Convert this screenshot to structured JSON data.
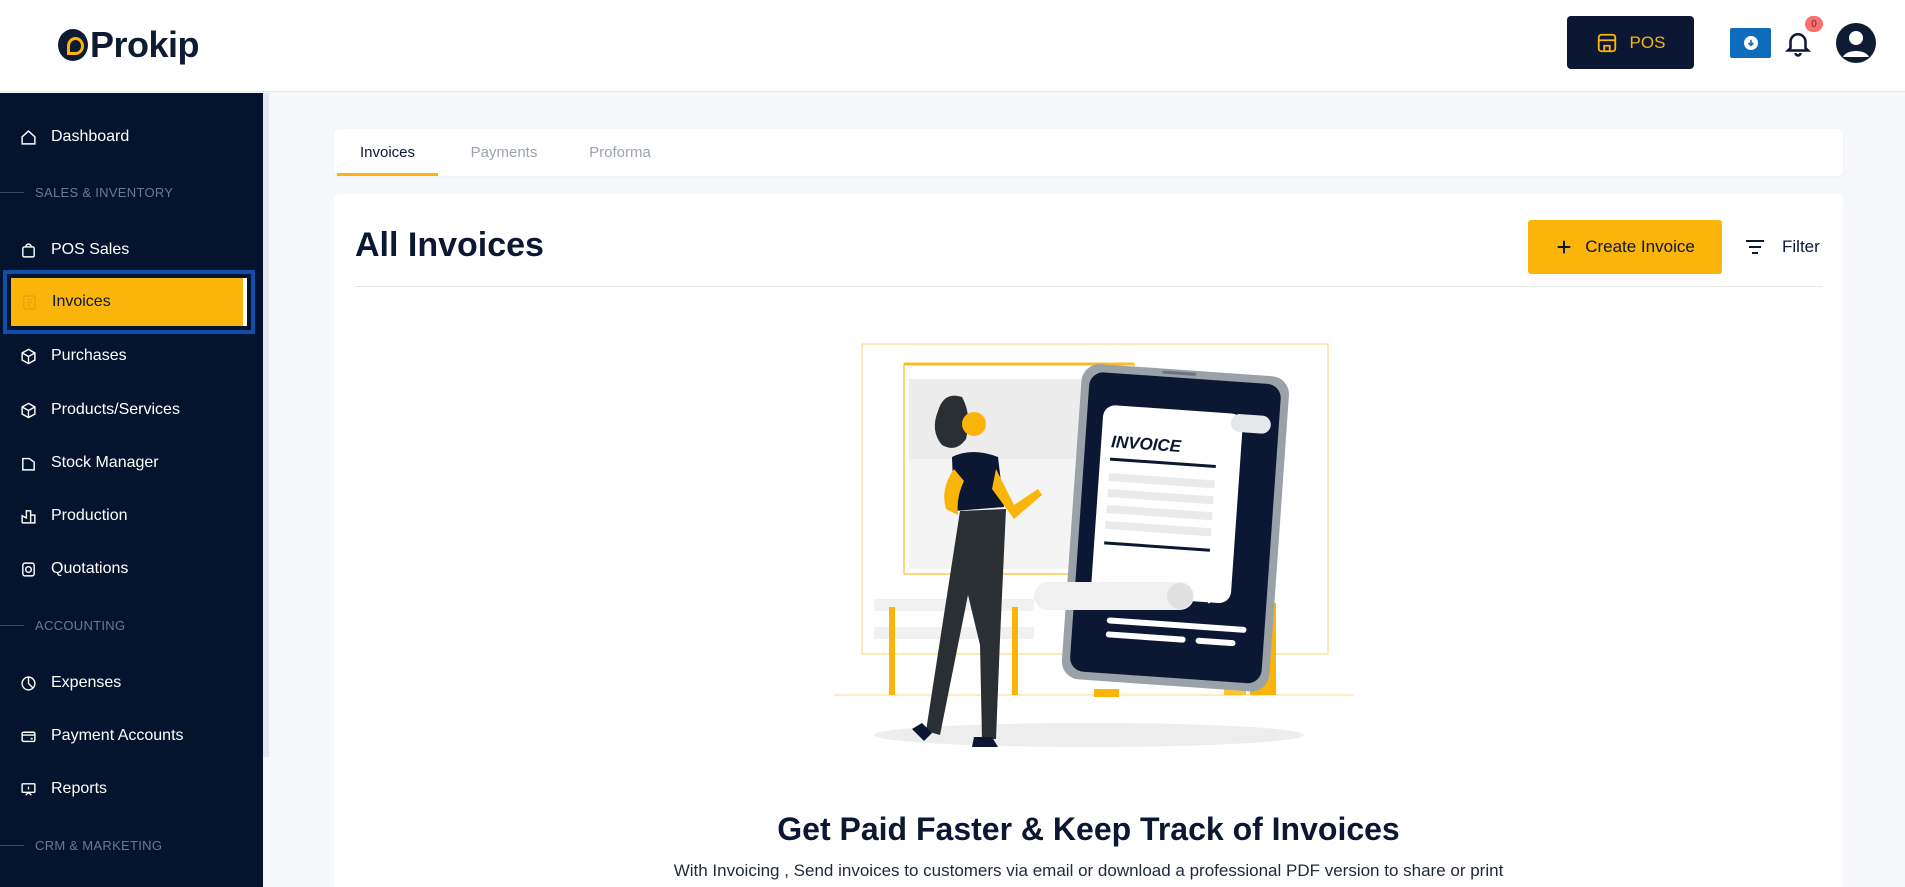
{
  "app": {
    "name": "Prokip"
  },
  "header": {
    "pos_label": "POS",
    "notification_count": "0",
    "icons": {
      "pos": "store-icon",
      "download": "download-icon",
      "bell": "bell-icon",
      "user": "user-avatar-icon"
    }
  },
  "sidebar": {
    "items": [
      {
        "label": "Dashboard",
        "icon": "home-icon"
      },
      {
        "section": "SALES & INVENTORY"
      },
      {
        "label": "POS Sales",
        "icon": "shopping-bag-icon"
      },
      {
        "label": "Invoices",
        "icon": "invoice-icon",
        "active": true
      },
      {
        "label": "Purchases",
        "icon": "box-icon"
      },
      {
        "label": "Products/Services",
        "icon": "cube-icon"
      },
      {
        "label": "Stock Manager",
        "icon": "folder-icon"
      },
      {
        "label": "Production",
        "icon": "factory-icon"
      },
      {
        "label": "Quotations",
        "icon": "quote-icon"
      },
      {
        "section": "ACCOUNTING"
      },
      {
        "label": "Expenses",
        "icon": "pie-icon"
      },
      {
        "label": "Payment Accounts",
        "icon": "wallet-icon"
      },
      {
        "label": "Reports",
        "icon": "presentation-icon"
      },
      {
        "section": "CRM & MARKETING"
      }
    ]
  },
  "tabs": [
    {
      "label": "Invoices",
      "active": true
    },
    {
      "label": "Payments",
      "active": false
    },
    {
      "label": "Proforma",
      "active": false
    }
  ],
  "main": {
    "title": "All Invoices",
    "create_label": "Create Invoice",
    "filter_label": "Filter",
    "illustration_text": "INVOICE",
    "illustration_currency": "$",
    "empty_headline": "Get Paid Faster & Keep Track of Invoices",
    "empty_subline": "With Invoicing , Send invoices to customers via email or download a professional PDF version to share or print"
  },
  "colors": {
    "accent": "#fbb40a",
    "navy": "#05142e",
    "focus_outline": "#0f4fa8",
    "download_blue": "#0f6cbd"
  }
}
